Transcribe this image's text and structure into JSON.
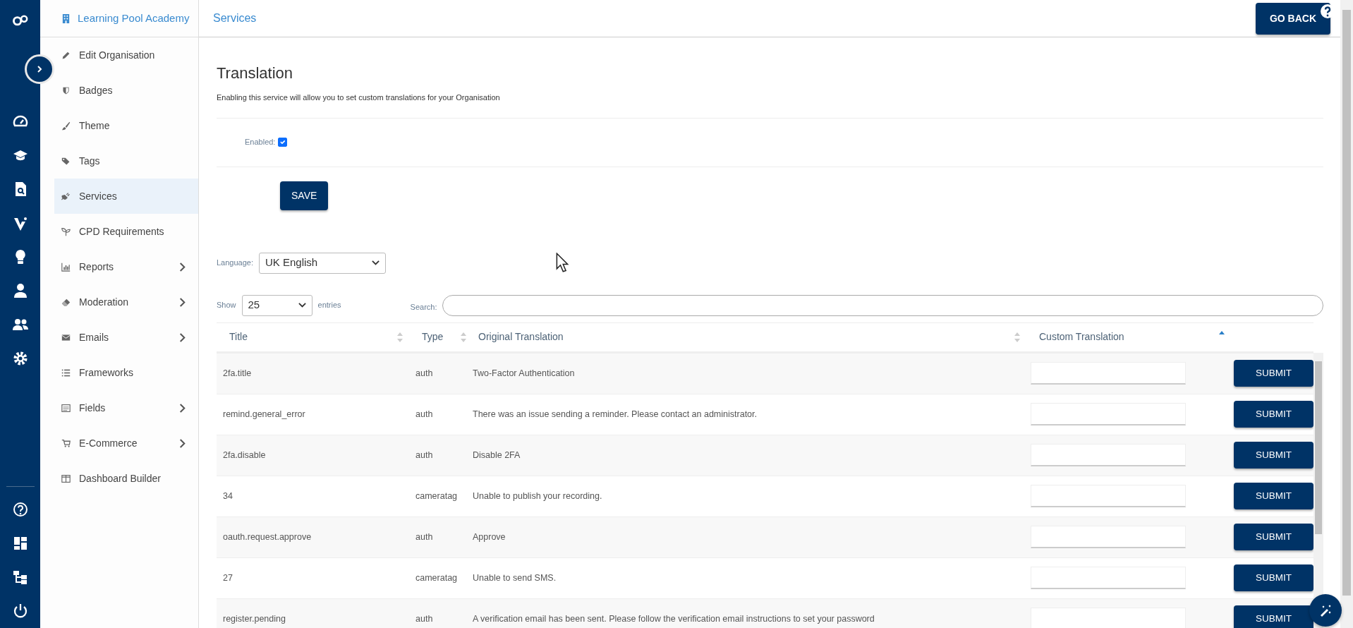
{
  "sidebar": {
    "organisation": "Learning Pool Academy",
    "items": [
      {
        "label": "Edit Organisation",
        "selected": false,
        "expandable": false
      },
      {
        "label": "Badges",
        "selected": false,
        "expandable": false
      },
      {
        "label": "Theme",
        "selected": false,
        "expandable": false
      },
      {
        "label": "Tags",
        "selected": false,
        "expandable": false
      },
      {
        "label": "Services",
        "selected": true,
        "expandable": false
      },
      {
        "label": "CPD Requirements",
        "selected": false,
        "expandable": false
      },
      {
        "label": "Reports",
        "selected": false,
        "expandable": true
      },
      {
        "label": "Moderation",
        "selected": false,
        "expandable": true
      },
      {
        "label": "Emails",
        "selected": false,
        "expandable": true
      },
      {
        "label": "Frameworks",
        "selected": false,
        "expandable": false
      },
      {
        "label": "Fields",
        "selected": false,
        "expandable": true
      },
      {
        "label": "E-Commerce",
        "selected": false,
        "expandable": true
      },
      {
        "label": "Dashboard Builder",
        "selected": false,
        "expandable": false
      }
    ]
  },
  "header": {
    "breadcrumb": "Services",
    "go_back": "GO BACK"
  },
  "service": {
    "title": "Translation",
    "description": "Enabling this service will allow you to set custom translations for your Organisation",
    "enabled_label": "Enabled:",
    "enabled": true,
    "save": "SAVE"
  },
  "language": {
    "label": "Language:",
    "value": "UK English"
  },
  "table_controls": {
    "show_label": "Show",
    "page_size": "25",
    "entries_label": "entries",
    "search_label": "Search:"
  },
  "table": {
    "columns": [
      {
        "label": "Title",
        "sorted_ascending": false
      },
      {
        "label": "Type",
        "sorted_ascending": false
      },
      {
        "label": "Original Translation",
        "sorted_ascending": false
      },
      {
        "label": "Custom Translation",
        "sorted_ascending": true
      }
    ],
    "rows": [
      {
        "title": "2fa.title",
        "type": "auth",
        "original": "Two-Factor Authentication",
        "action": "SUBMIT"
      },
      {
        "title": "remind.general_error",
        "type": "auth",
        "original": "There was an issue sending a reminder. Please contact an administrator.",
        "action": "SUBMIT"
      },
      {
        "title": "2fa.disable",
        "type": "auth",
        "original": "Disable 2FA",
        "action": "SUBMIT"
      },
      {
        "title": "34",
        "type": "cameratag",
        "original": "Unable to publish your recording.",
        "action": "SUBMIT"
      },
      {
        "title": "oauth.request.approve",
        "type": "auth",
        "original": "Approve",
        "action": "SUBMIT"
      },
      {
        "title": "27",
        "type": "cameratag",
        "original": "Unable to send SMS.",
        "action": "SUBMIT"
      },
      {
        "title": "register.pending",
        "type": "auth",
        "original": "A verification email has been sent. Please follow the verification email instructions to set your password",
        "action": "SUBMIT"
      }
    ]
  }
}
